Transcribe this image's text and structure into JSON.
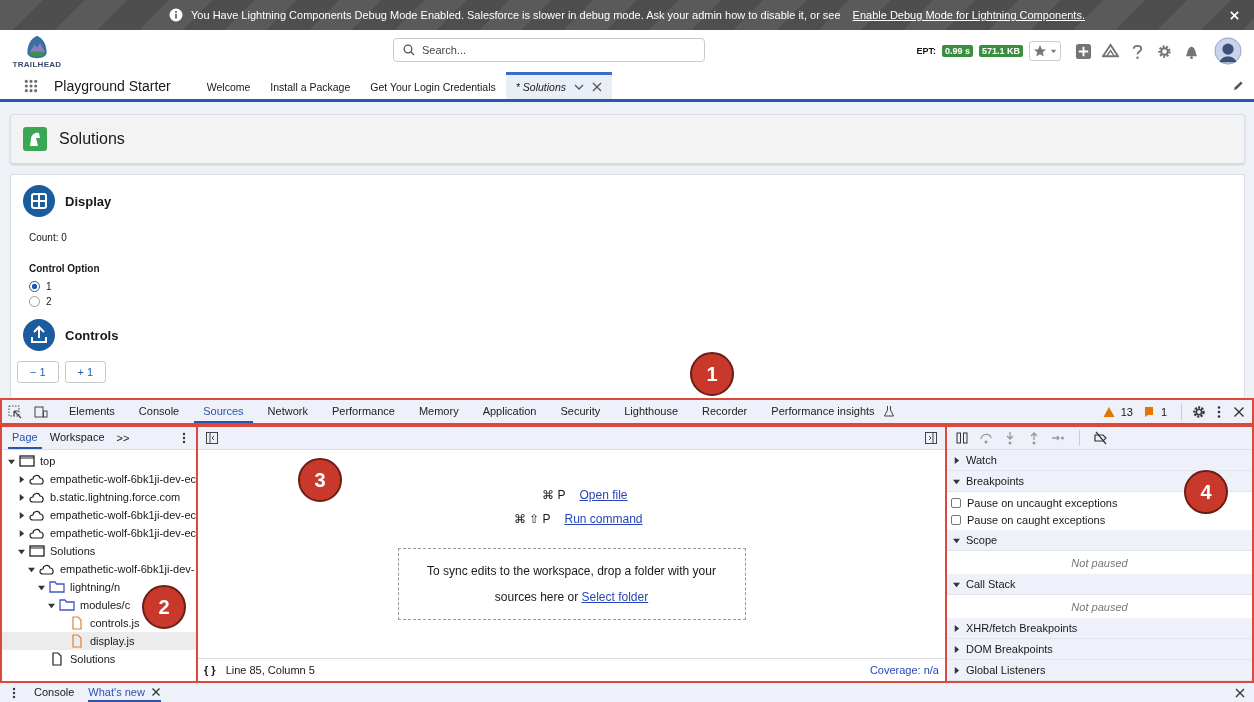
{
  "banner": {
    "message": "You Have Lightning Components Debug Mode Enabled. Salesforce is slower in debug mode. Ask your admin how to disable it, or see",
    "link": "Enable Debug Mode for Lightning Components."
  },
  "header": {
    "logo_text": "TRAILHEAD",
    "search_placeholder": "Search...",
    "ept_label": "EPT:",
    "ept_time": "0.99 s",
    "ept_size": "571.1 KB"
  },
  "nav": {
    "app_name": "Playground Starter",
    "tabs": [
      {
        "label": "Welcome",
        "selected": false
      },
      {
        "label": "Install a Package",
        "selected": false
      },
      {
        "label": "Get Your Login Credentials",
        "selected": false
      },
      {
        "label": "* Solutions",
        "selected": true
      }
    ]
  },
  "page": {
    "title": "Solutions",
    "display": {
      "title": "Display",
      "count": "Count: 0",
      "option_label": "Control Option",
      "options": [
        {
          "label": "1",
          "selected": true
        },
        {
          "label": "2",
          "selected": false
        }
      ]
    },
    "controls": {
      "title": "Controls",
      "buttons": [
        "− 1",
        "+ 1"
      ]
    }
  },
  "devtools": {
    "tabs": [
      {
        "label": "Elements",
        "selected": false
      },
      {
        "label": "Console",
        "selected": false
      },
      {
        "label": "Sources",
        "selected": true
      },
      {
        "label": "Network",
        "selected": false
      },
      {
        "label": "Performance",
        "selected": false
      },
      {
        "label": "Memory",
        "selected": false
      },
      {
        "label": "Application",
        "selected": false
      },
      {
        "label": "Security",
        "selected": false
      },
      {
        "label": "Lighthouse",
        "selected": false
      },
      {
        "label": "Recorder",
        "selected": false
      },
      {
        "label": "Performance insights",
        "selected": false
      }
    ],
    "warnings": "13",
    "issues": "1",
    "navigator": {
      "tabs": [
        {
          "label": "Page",
          "selected": true
        },
        {
          "label": "Workspace",
          "selected": false
        }
      ],
      "more": ">>",
      "tree": [
        {
          "label": "top",
          "kind": "frame",
          "expanded": true,
          "selected": false,
          "children": [
            {
              "label": "empathetic-wolf-6bk1ji-dev-ec",
              "kind": "cloud",
              "expanded": false,
              "selected": false
            },
            {
              "label": "b.static.lightning.force.com",
              "kind": "cloud",
              "expanded": false,
              "selected": false
            },
            {
              "label": "empathetic-wolf-6bk1ji-dev-ec",
              "kind": "cloud",
              "expanded": false,
              "selected": false
            },
            {
              "label": "empathetic-wolf-6bk1ji-dev-ec",
              "kind": "cloud",
              "expanded": false,
              "selected": false
            },
            {
              "label": "Solutions",
              "kind": "frame",
              "expanded": true,
              "selected": false,
              "children": [
                {
                  "label": "empathetic-wolf-6bk1ji-dev-",
                  "kind": "cloud",
                  "expanded": true,
                  "selected": false,
                  "children": [
                    {
                      "label": "lightning/n",
                      "kind": "folder",
                      "expanded": true,
                      "selected": false,
                      "children": [
                        {
                          "label": "modules/c",
                          "kind": "folder",
                          "expanded": true,
                          "selected": false,
                          "children": [
                            {
                              "label": "controls.js",
                              "kind": "file",
                              "selected": false
                            },
                            {
                              "label": "display.js",
                              "kind": "file",
                              "selected": true
                            }
                          ]
                        }
                      ]
                    },
                    {
                      "label": "Solutions",
                      "kind": "document",
                      "selected": false
                    }
                  ]
                }
              ]
            }
          ]
        }
      ]
    },
    "editor": {
      "shortcuts": [
        {
          "keys": "⌘ P",
          "label": "Open file"
        },
        {
          "keys": "⌘ ⇧ P",
          "label": "Run command"
        }
      ],
      "drop_text": "To sync edits to the workspace, drop a folder with your sources here or",
      "drop_link": "Select folder",
      "braces": "{ }",
      "position": "Line 85, Column 5",
      "coverage": "Coverage: n/a"
    },
    "debugger": {
      "sections": [
        {
          "title": "Watch",
          "expanded": false
        },
        {
          "title": "Breakpoints",
          "expanded": true,
          "kind": "checkboxes",
          "items": [
            {
              "label": "Pause on uncaught exceptions",
              "checked": false
            },
            {
              "label": "Pause on caught exceptions",
              "checked": false
            }
          ]
        },
        {
          "title": "Scope",
          "expanded": true,
          "kind": "message",
          "message": "Not paused"
        },
        {
          "title": "Call Stack",
          "expanded": true,
          "kind": "message",
          "message": "Not paused"
        },
        {
          "title": "XHR/fetch Breakpoints",
          "expanded": false
        },
        {
          "title": "DOM Breakpoints",
          "expanded": false
        },
        {
          "title": "Global Listeners",
          "expanded": false
        }
      ]
    },
    "drawer": {
      "tabs": [
        {
          "label": "Console",
          "selected": false
        },
        {
          "label": "What's new",
          "selected": true
        }
      ]
    }
  },
  "callouts": [
    "1",
    "2",
    "3",
    "4"
  ]
}
